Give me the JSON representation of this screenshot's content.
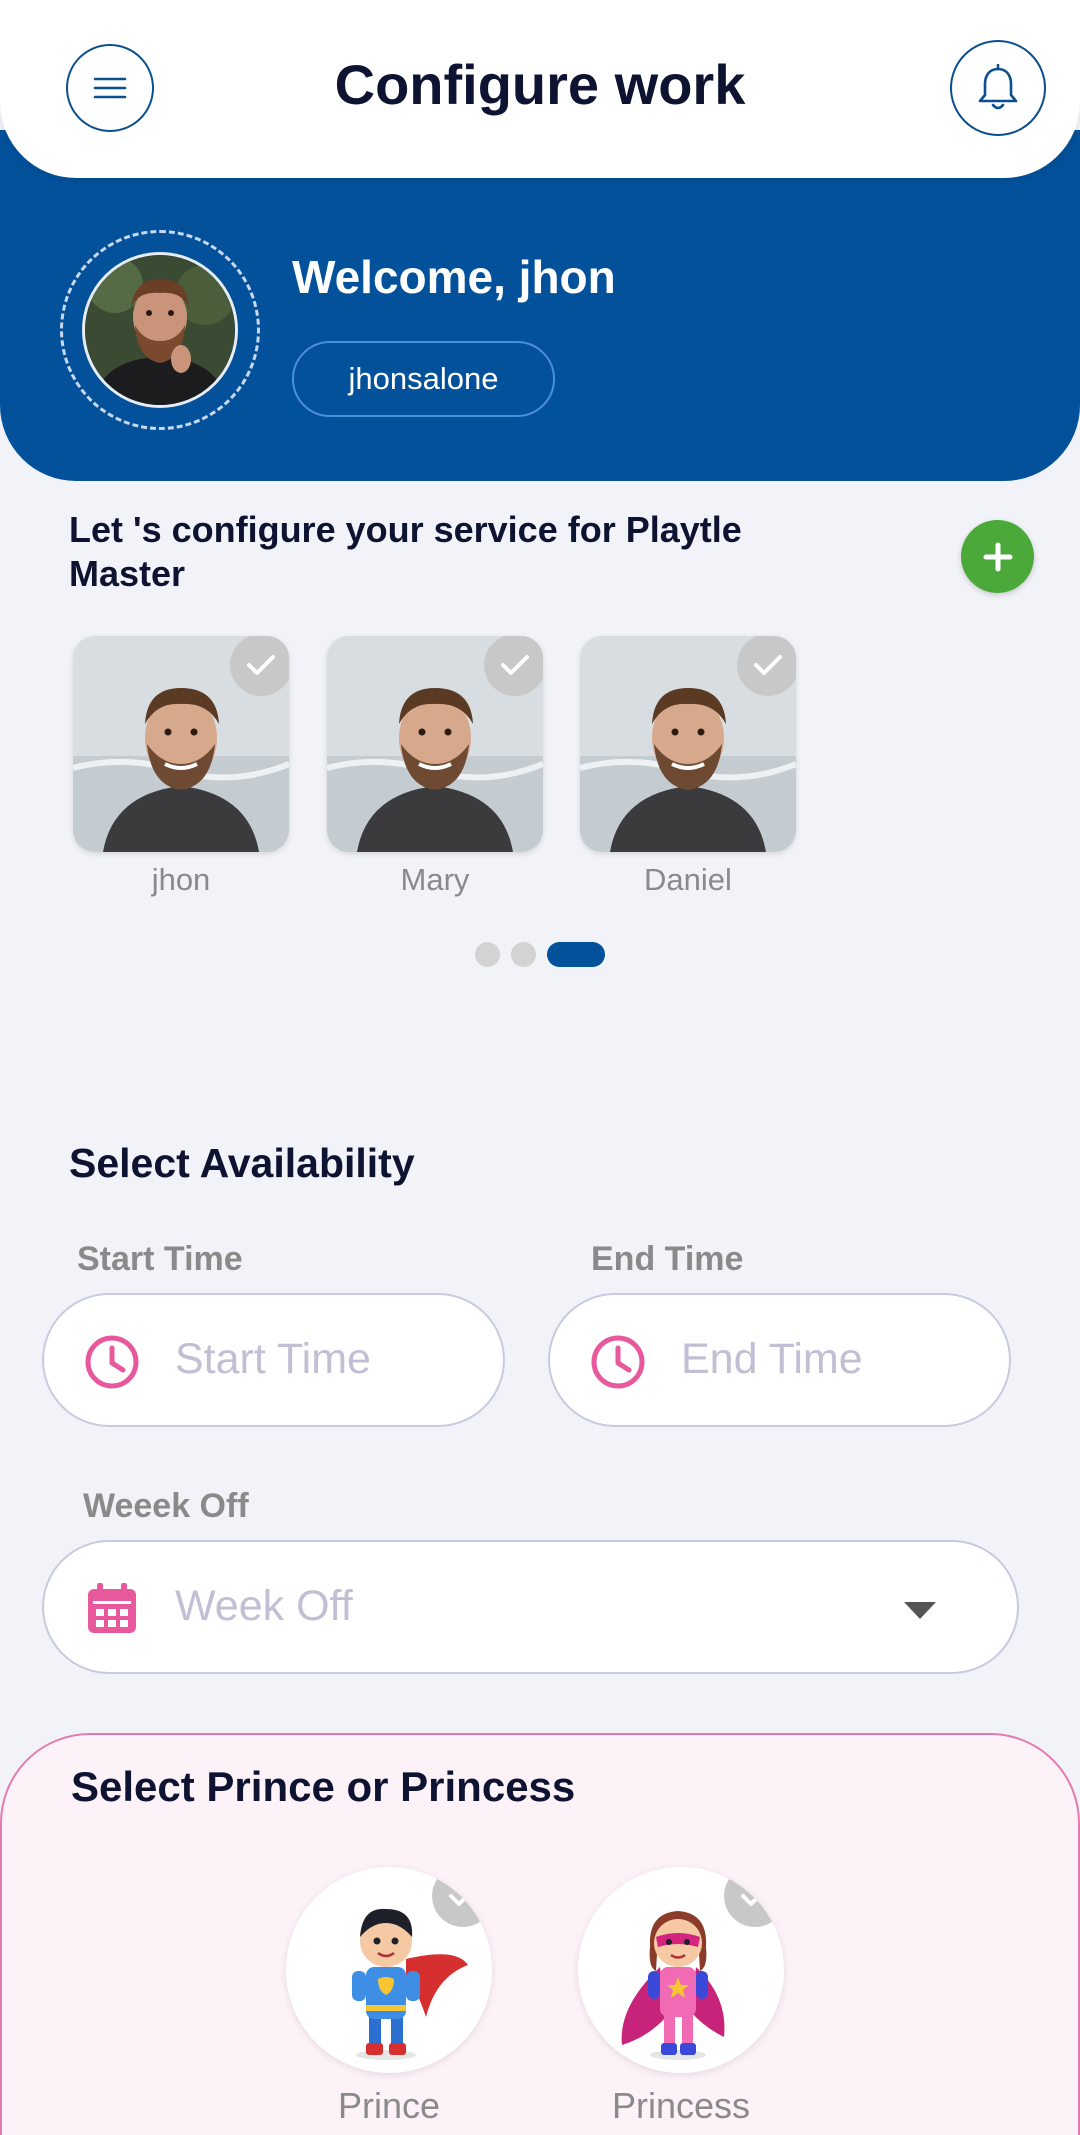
{
  "header": {
    "title": "Configure work",
    "menu_icon": "menu-icon",
    "bell_icon": "bell-icon"
  },
  "welcome": {
    "greeting": "Welcome, jhon",
    "username": "jhonsalone"
  },
  "configure": {
    "title": "Let 's configure your service for Playtle Master",
    "add_icon": "plus-icon",
    "people": [
      {
        "name": "jhon",
        "selected": true
      },
      {
        "name": "Mary",
        "selected": true
      },
      {
        "name": "Daniel",
        "selected": true
      }
    ],
    "pagination": {
      "pages": 3,
      "active": 3
    }
  },
  "availability": {
    "title": "Select Availability",
    "start_label": "Start Time",
    "start_placeholder": "Start Time",
    "end_label": "End Time",
    "end_placeholder": "End Time",
    "weekoff_label": "Weeek Off",
    "weekoff_placeholder": "Week Off"
  },
  "prince_princess": {
    "title": "Select Prince or Princess",
    "options": [
      {
        "name": "Prince",
        "selected": true
      },
      {
        "name": "Princess",
        "selected": true
      }
    ]
  },
  "colors": {
    "primary_blue": "#03519b",
    "accent_pink": "#e8589d",
    "add_green": "#4ba93a"
  }
}
